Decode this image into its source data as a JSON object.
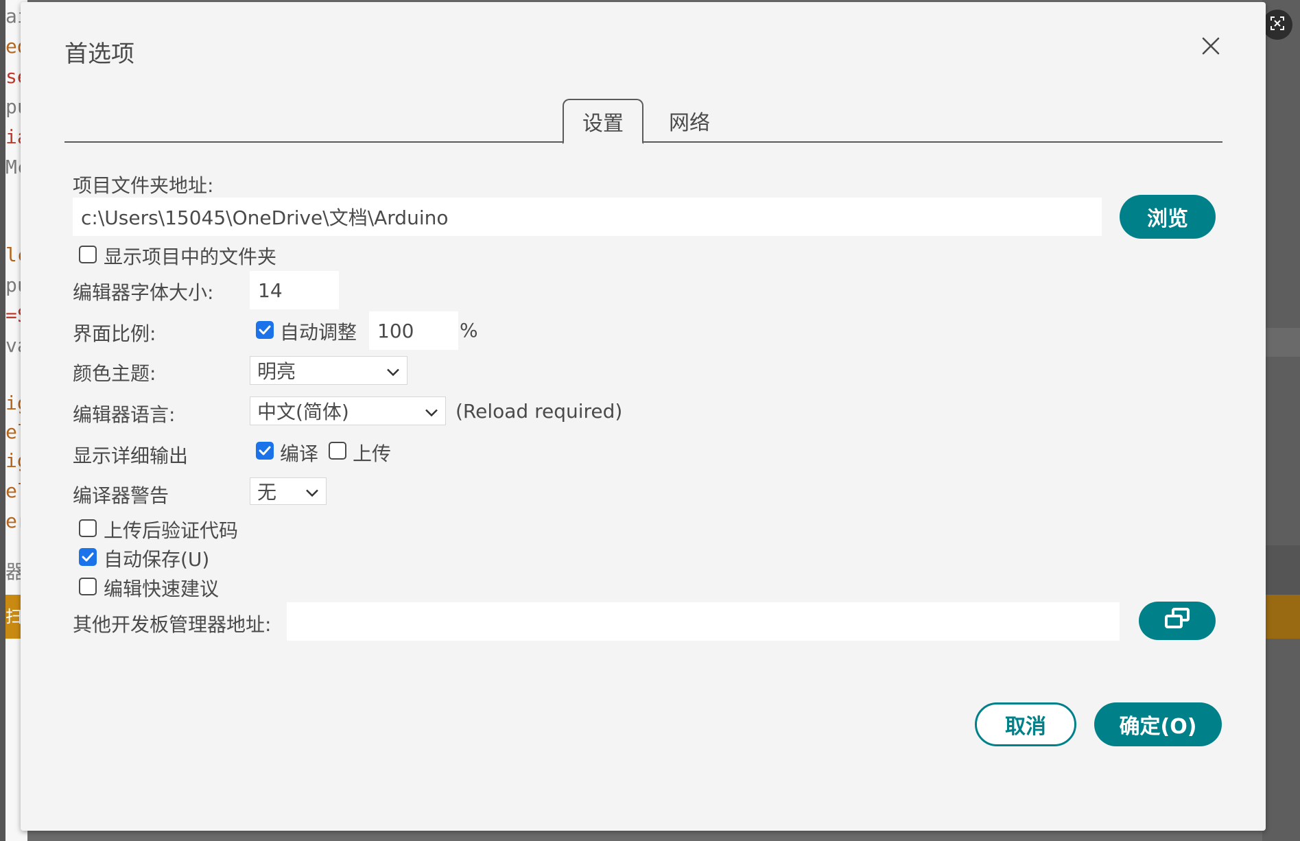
{
  "dialog": {
    "title": "首选项",
    "tabs": [
      {
        "label": "设置",
        "active": true
      },
      {
        "label": "网络",
        "active": false
      }
    ]
  },
  "settings": {
    "sketchbook_label": "项目文件夹地址:",
    "sketchbook_path": "c:\\Users\\15045\\OneDrive\\文档\\Arduino",
    "browse_label": "浏览",
    "show_files_label": "显示项目中的文件夹",
    "show_files_checked": false,
    "font_size_label": "编辑器字体大小:",
    "font_size_value": "14",
    "scale_label": "界面比例:",
    "auto_scale_label": "自动调整",
    "auto_scale_checked": true,
    "scale_value": "100",
    "scale_unit": "%",
    "theme_label": "颜色主题:",
    "theme_value": "明亮",
    "language_label": "编辑器语言:",
    "language_value": "中文(简体)",
    "reload_note": "(Reload required)",
    "verbose_label": "显示详细输出",
    "verbose_compile_label": "编译",
    "verbose_compile_checked": true,
    "verbose_upload_label": "上传",
    "verbose_upload_checked": false,
    "warnings_label": "编译器警告",
    "warnings_value": "无",
    "verify_label": "上传后验证代码",
    "verify_checked": false,
    "autosave_label": "自动保存(U)",
    "autosave_checked": true,
    "quick_suggest_label": "编辑快速建议",
    "quick_suggest_checked": false,
    "board_urls_label": "其他开发板管理器地址:",
    "board_urls_value": ""
  },
  "footer": {
    "cancel_label": "取消",
    "ok_label": "确定(O)"
  },
  "background": {
    "editor_lines": [
      "ai",
      "ed",
      "se",
      "pu",
      "ia",
      "Mc",
      "",
      "lc",
      "pu",
      "=S",
      "va",
      "",
      "ig",
      "el",
      "ig",
      "el",
      "er",
      "",
      "器",
      "",
      "扫"
    ]
  },
  "colors": {
    "accent": "#00818a",
    "checkbox": "#1a73e8"
  },
  "icons": {
    "close": "close-icon",
    "chevron": "chevron-down-icon",
    "edit_urls": "window-stack-icon",
    "screenshot": "screenshot-icon"
  }
}
